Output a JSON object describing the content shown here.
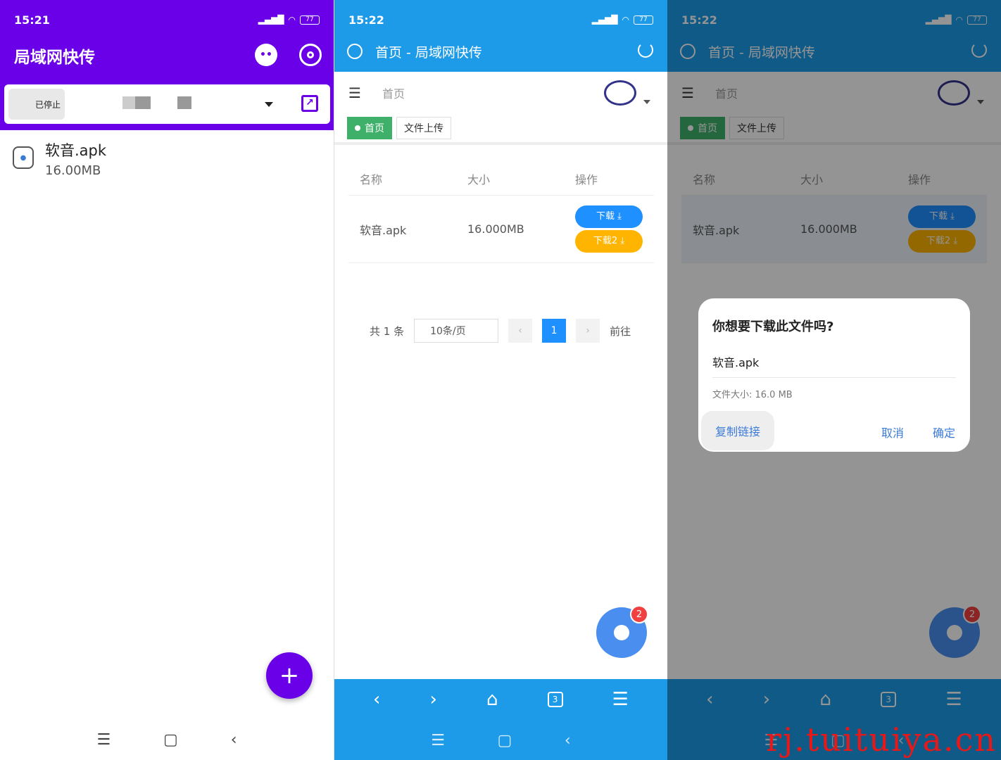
{
  "panel1": {
    "status": {
      "time": "15:21",
      "battery": "77"
    },
    "app_title": "局域网快传",
    "server_chip": "已停止",
    "file": {
      "name": "软音.apk",
      "size": "16.00MB"
    },
    "fab": "+"
  },
  "panel2": {
    "status": {
      "time": "15:22",
      "battery": "77"
    },
    "page_title": "首页 - 局域网快传",
    "breadcrumb": "首页",
    "tabs": [
      "首页",
      "文件上传"
    ],
    "table": {
      "headers": [
        "名称",
        "大小",
        "操作"
      ],
      "rows": [
        {
          "name": "软音.apk",
          "size": "16.000MB",
          "btn1": "下载 ⤓",
          "btn2": "下载2 ⤓"
        }
      ]
    },
    "pager": {
      "total": "共 1 条",
      "page_size": "10条/页",
      "current": "1",
      "goto": "前往"
    },
    "chat_badge": "2",
    "tab_count": "3"
  },
  "panel3": {
    "status": {
      "time": "15:22",
      "battery": "77"
    },
    "dialog": {
      "title": "你想要下载此文件吗?",
      "file": "软音.apk",
      "size": "文件大小: 16.0 MB",
      "copy": "复制链接",
      "cancel": "取消",
      "ok": "确定"
    },
    "watermark": "rj.tuituiya.cn"
  }
}
